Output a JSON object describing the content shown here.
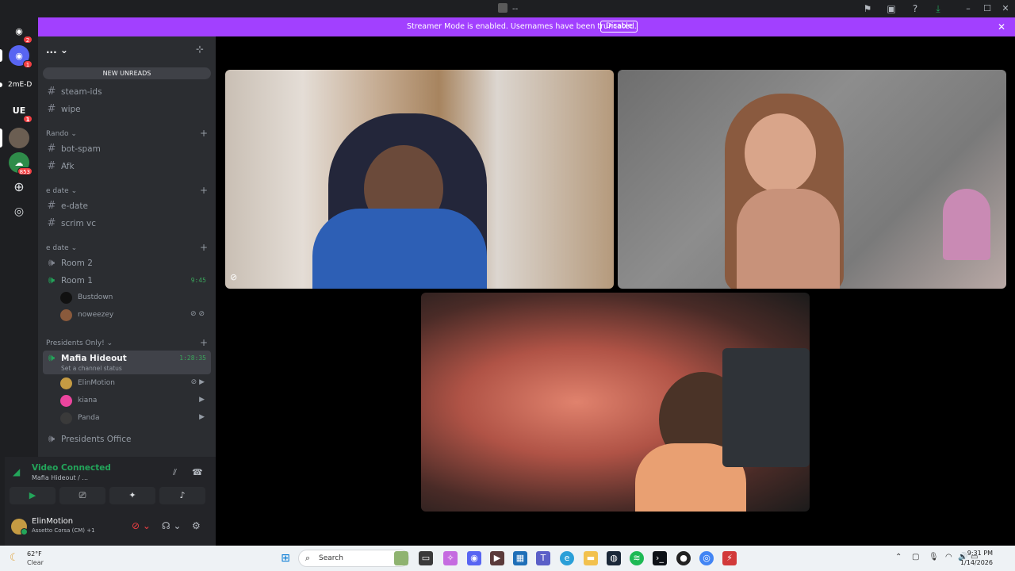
{
  "window": {
    "title": "--"
  },
  "streamer_banner": {
    "message": "Streamer Mode is enabled. Usernames have been truncated.",
    "disable_label": "Disable"
  },
  "server_rail": {
    "badges": [
      "2",
      "1",
      "1",
      "853"
    ],
    "server_text": "2mE-D"
  },
  "sidebar": {
    "server_name": "...",
    "new_unreads": "NEW UNREADS",
    "categories": {
      "rando": "Rando",
      "edate1": "e date",
      "edate2": "e date",
      "presidents": "Presidents Only!"
    },
    "channels": {
      "steam_ids": "steam-ids",
      "wipe": "wipe",
      "bot_spam": "bot-spam",
      "afk": "Afk",
      "e_date": "e-date",
      "scrim_vc": "scrim vc",
      "room2": "Room 2",
      "room1": "Room 1",
      "room1_timer": "9:45",
      "mafia": "Mafia Hideout",
      "mafia_timer": "1:28:35",
      "mafia_status": "Set a channel status",
      "presidents_office": "Presidents Office"
    },
    "room1_users": [
      "Bustdown",
      "noweezey"
    ],
    "mafia_users": [
      "ElinMotion",
      "kiana",
      "Panda"
    ]
  },
  "voice_panel": {
    "title": "Video Connected",
    "subtitle": "Mafia Hideout / ...",
    "user_name": "ElinMotion",
    "user_activity": "Assetto Corsa (CM) +1"
  },
  "taskbar": {
    "temp": "62°F",
    "condition": "Clear",
    "search_placeholder": "Search",
    "time": "9:31 PM",
    "date": "1/14/2026"
  },
  "colors": {
    "streamer_purple": "#a240ff",
    "voice_green": "#23a55a",
    "sidebar_bg": "#2b2d31"
  }
}
